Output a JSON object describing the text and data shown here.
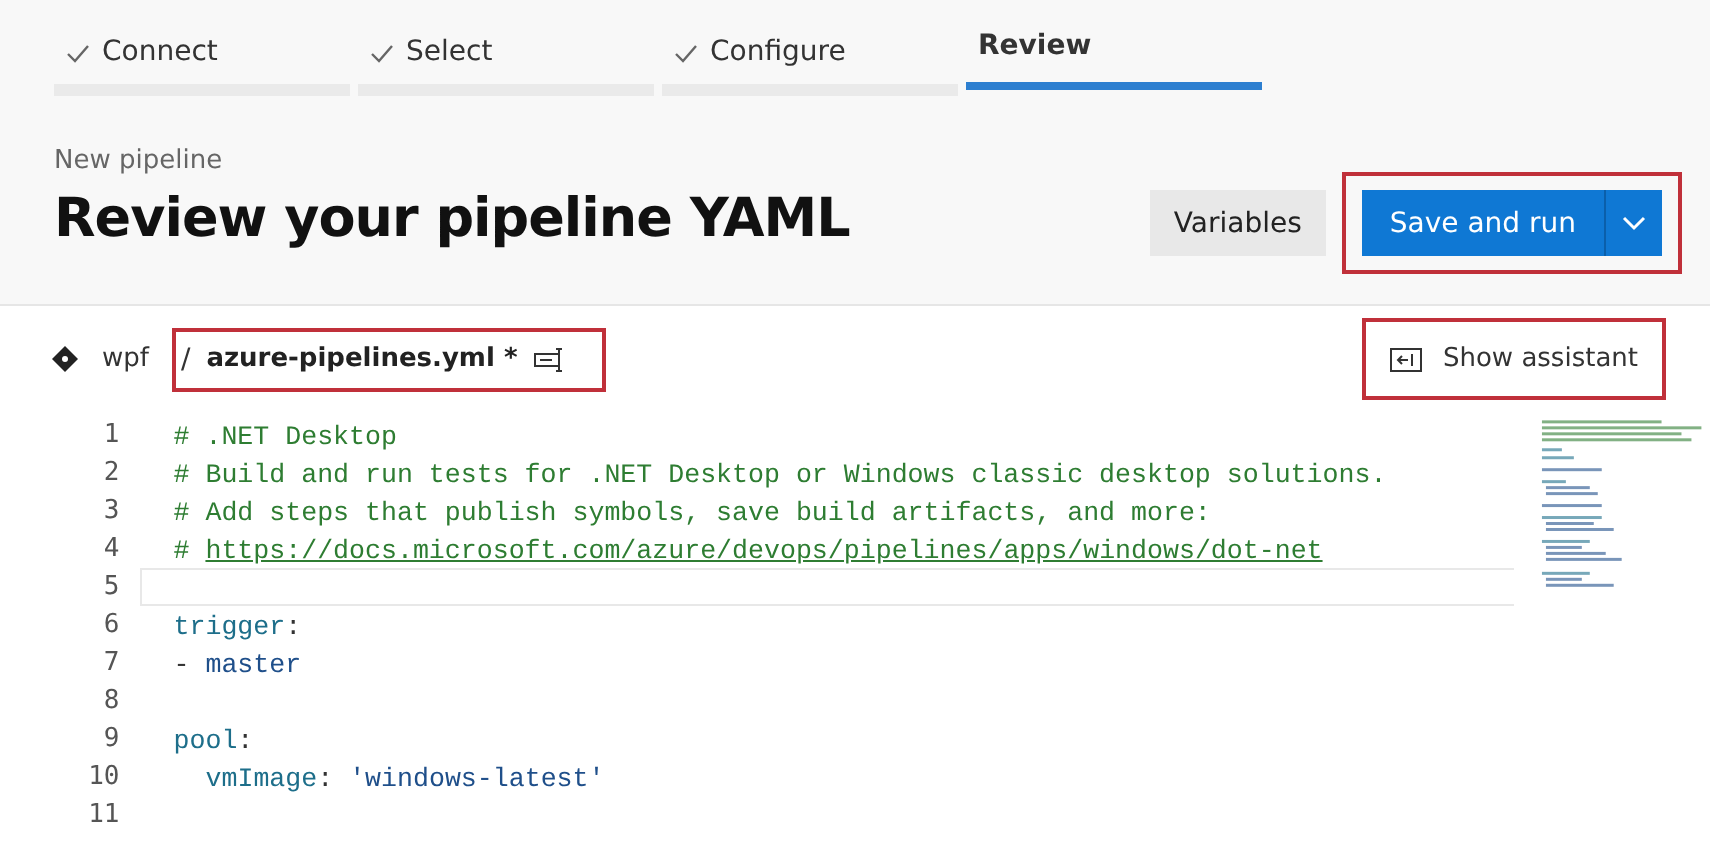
{
  "steps": [
    {
      "label": "Connect",
      "done": true,
      "selected": false
    },
    {
      "label": "Select",
      "done": true,
      "selected": false
    },
    {
      "label": "Configure",
      "done": true,
      "selected": false
    },
    {
      "label": "Review",
      "done": false,
      "selected": true
    }
  ],
  "header": {
    "breadcrumb": "New pipeline",
    "title": "Review your pipeline YAML",
    "variables_button": "Variables",
    "save_button": "Save and run",
    "save_highlighted": true
  },
  "file_bar": {
    "repo": "wpf",
    "separator": "/",
    "file_name": "azure-pipelines.yml *",
    "file_highlighted": true,
    "assistant_button": "Show assistant",
    "assistant_highlighted": true
  },
  "editor": {
    "lines": [
      {
        "number": "1",
        "tokens": [
          {
            "kind": "comment",
            "text": "# .NET Desktop"
          }
        ]
      },
      {
        "number": "2",
        "tokens": [
          {
            "kind": "comment",
            "text": "# Build and run tests for .NET Desktop or Windows classic desktop solutions."
          }
        ]
      },
      {
        "number": "3",
        "tokens": [
          {
            "kind": "comment",
            "text": "# Add steps that publish symbols, save build artifacts, and more:"
          }
        ]
      },
      {
        "number": "4",
        "tokens": [
          {
            "kind": "comment",
            "text": "# "
          },
          {
            "kind": "link",
            "text": "https://docs.microsoft.com/azure/devops/pipelines/apps/windows/dot-net"
          }
        ]
      },
      {
        "number": "5",
        "current": true
      },
      {
        "number": "6",
        "tokens": [
          {
            "kind": "key",
            "text": "trigger"
          },
          {
            "kind": "punct",
            "text": ":"
          }
        ]
      },
      {
        "number": "7",
        "tokens": [
          {
            "kind": "punct",
            "text": "- "
          },
          {
            "kind": "value",
            "text": "master"
          }
        ]
      },
      {
        "number": "8"
      },
      {
        "number": "9",
        "tokens": [
          {
            "kind": "key",
            "text": "pool"
          },
          {
            "kind": "punct",
            "text": ":"
          }
        ]
      },
      {
        "number": "10",
        "indented": true,
        "tokens": [
          {
            "kind": "key",
            "text": "vmImage"
          },
          {
            "kind": "punct",
            "text": ": "
          },
          {
            "kind": "string",
            "text": "'windows-latest'"
          }
        ]
      },
      {
        "number": "11"
      }
    ]
  }
}
